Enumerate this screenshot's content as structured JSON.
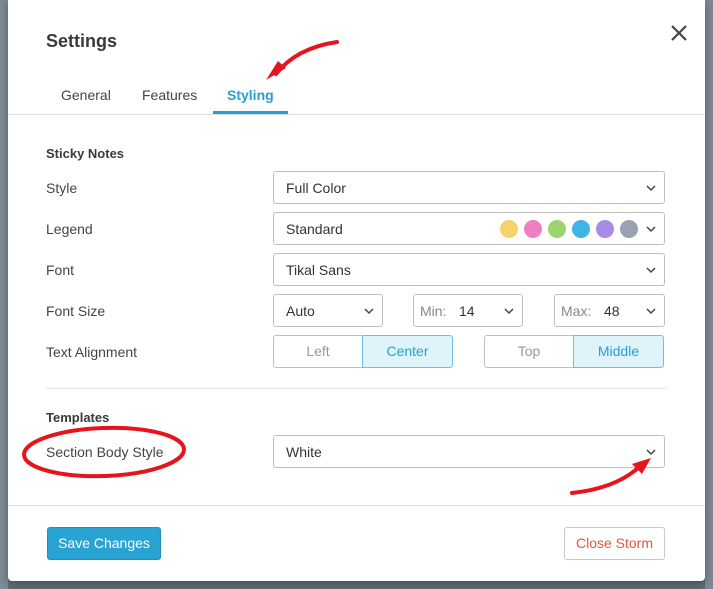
{
  "dialog": {
    "title": "Settings"
  },
  "tabs": [
    {
      "label": "General"
    },
    {
      "label": "Features"
    },
    {
      "label": "Styling",
      "active": true
    }
  ],
  "sticky_notes": {
    "heading": "Sticky Notes",
    "style": {
      "label": "Style",
      "value": "Full Color"
    },
    "legend": {
      "label": "Legend",
      "value": "Standard",
      "colors": [
        "#f5d36a",
        "#ef7fbf",
        "#9fd46c",
        "#3fb5e6",
        "#a98ae6",
        "#97a3b0"
      ]
    },
    "font": {
      "label": "Font",
      "value": "Tikal Sans"
    },
    "font_size": {
      "label": "Font Size",
      "value": "Auto",
      "min_label": "Min:",
      "min_value": "14",
      "max_label": "Max:",
      "max_value": "48"
    },
    "text_alignment": {
      "label": "Text Alignment",
      "horizontal": [
        "Left",
        "Center"
      ],
      "horizontal_selected": "Center",
      "vertical": [
        "Top",
        "Middle"
      ],
      "vertical_selected": "Middle"
    }
  },
  "templates": {
    "heading": "Templates",
    "section_body_style": {
      "label": "Section Body Style",
      "value": "White"
    }
  },
  "footer": {
    "save_label": "Save Changes",
    "close_label": "Close Storm"
  },
  "colors": {
    "accent": "#2a9fd0",
    "danger": "#e05a3a",
    "annotation": "#e8141b"
  },
  "icons": {
    "close": "close-icon",
    "chevron": "chevron-down-icon"
  }
}
